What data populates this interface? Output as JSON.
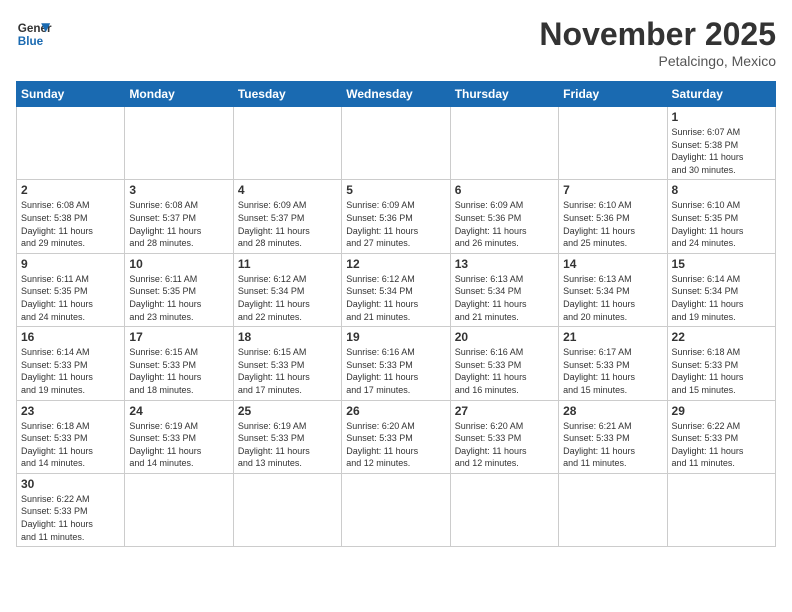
{
  "header": {
    "logo_general": "General",
    "logo_blue": "Blue",
    "month_title": "November 2025",
    "location": "Petalcingo, Mexico"
  },
  "weekdays": [
    "Sunday",
    "Monday",
    "Tuesday",
    "Wednesday",
    "Thursday",
    "Friday",
    "Saturday"
  ],
  "weeks": [
    [
      {
        "day": "",
        "info": ""
      },
      {
        "day": "",
        "info": ""
      },
      {
        "day": "",
        "info": ""
      },
      {
        "day": "",
        "info": ""
      },
      {
        "day": "",
        "info": ""
      },
      {
        "day": "",
        "info": ""
      },
      {
        "day": "1",
        "info": "Sunrise: 6:07 AM\nSunset: 5:38 PM\nDaylight: 11 hours\nand 30 minutes."
      }
    ],
    [
      {
        "day": "2",
        "info": "Sunrise: 6:08 AM\nSunset: 5:38 PM\nDaylight: 11 hours\nand 29 minutes."
      },
      {
        "day": "3",
        "info": "Sunrise: 6:08 AM\nSunset: 5:37 PM\nDaylight: 11 hours\nand 28 minutes."
      },
      {
        "day": "4",
        "info": "Sunrise: 6:09 AM\nSunset: 5:37 PM\nDaylight: 11 hours\nand 28 minutes."
      },
      {
        "day": "5",
        "info": "Sunrise: 6:09 AM\nSunset: 5:36 PM\nDaylight: 11 hours\nand 27 minutes."
      },
      {
        "day": "6",
        "info": "Sunrise: 6:09 AM\nSunset: 5:36 PM\nDaylight: 11 hours\nand 26 minutes."
      },
      {
        "day": "7",
        "info": "Sunrise: 6:10 AM\nSunset: 5:36 PM\nDaylight: 11 hours\nand 25 minutes."
      },
      {
        "day": "8",
        "info": "Sunrise: 6:10 AM\nSunset: 5:35 PM\nDaylight: 11 hours\nand 24 minutes."
      }
    ],
    [
      {
        "day": "9",
        "info": "Sunrise: 6:11 AM\nSunset: 5:35 PM\nDaylight: 11 hours\nand 24 minutes."
      },
      {
        "day": "10",
        "info": "Sunrise: 6:11 AM\nSunset: 5:35 PM\nDaylight: 11 hours\nand 23 minutes."
      },
      {
        "day": "11",
        "info": "Sunrise: 6:12 AM\nSunset: 5:34 PM\nDaylight: 11 hours\nand 22 minutes."
      },
      {
        "day": "12",
        "info": "Sunrise: 6:12 AM\nSunset: 5:34 PM\nDaylight: 11 hours\nand 21 minutes."
      },
      {
        "day": "13",
        "info": "Sunrise: 6:13 AM\nSunset: 5:34 PM\nDaylight: 11 hours\nand 21 minutes."
      },
      {
        "day": "14",
        "info": "Sunrise: 6:13 AM\nSunset: 5:34 PM\nDaylight: 11 hours\nand 20 minutes."
      },
      {
        "day": "15",
        "info": "Sunrise: 6:14 AM\nSunset: 5:34 PM\nDaylight: 11 hours\nand 19 minutes."
      }
    ],
    [
      {
        "day": "16",
        "info": "Sunrise: 6:14 AM\nSunset: 5:33 PM\nDaylight: 11 hours\nand 19 minutes."
      },
      {
        "day": "17",
        "info": "Sunrise: 6:15 AM\nSunset: 5:33 PM\nDaylight: 11 hours\nand 18 minutes."
      },
      {
        "day": "18",
        "info": "Sunrise: 6:15 AM\nSunset: 5:33 PM\nDaylight: 11 hours\nand 17 minutes."
      },
      {
        "day": "19",
        "info": "Sunrise: 6:16 AM\nSunset: 5:33 PM\nDaylight: 11 hours\nand 17 minutes."
      },
      {
        "day": "20",
        "info": "Sunrise: 6:16 AM\nSunset: 5:33 PM\nDaylight: 11 hours\nand 16 minutes."
      },
      {
        "day": "21",
        "info": "Sunrise: 6:17 AM\nSunset: 5:33 PM\nDaylight: 11 hours\nand 15 minutes."
      },
      {
        "day": "22",
        "info": "Sunrise: 6:18 AM\nSunset: 5:33 PM\nDaylight: 11 hours\nand 15 minutes."
      }
    ],
    [
      {
        "day": "23",
        "info": "Sunrise: 6:18 AM\nSunset: 5:33 PM\nDaylight: 11 hours\nand 14 minutes."
      },
      {
        "day": "24",
        "info": "Sunrise: 6:19 AM\nSunset: 5:33 PM\nDaylight: 11 hours\nand 14 minutes."
      },
      {
        "day": "25",
        "info": "Sunrise: 6:19 AM\nSunset: 5:33 PM\nDaylight: 11 hours\nand 13 minutes."
      },
      {
        "day": "26",
        "info": "Sunrise: 6:20 AM\nSunset: 5:33 PM\nDaylight: 11 hours\nand 12 minutes."
      },
      {
        "day": "27",
        "info": "Sunrise: 6:20 AM\nSunset: 5:33 PM\nDaylight: 11 hours\nand 12 minutes."
      },
      {
        "day": "28",
        "info": "Sunrise: 6:21 AM\nSunset: 5:33 PM\nDaylight: 11 hours\nand 11 minutes."
      },
      {
        "day": "29",
        "info": "Sunrise: 6:22 AM\nSunset: 5:33 PM\nDaylight: 11 hours\nand 11 minutes."
      }
    ],
    [
      {
        "day": "30",
        "info": "Sunrise: 6:22 AM\nSunset: 5:33 PM\nDaylight: 11 hours\nand 11 minutes."
      },
      {
        "day": "",
        "info": ""
      },
      {
        "day": "",
        "info": ""
      },
      {
        "day": "",
        "info": ""
      },
      {
        "day": "",
        "info": ""
      },
      {
        "day": "",
        "info": ""
      },
      {
        "day": "",
        "info": ""
      }
    ]
  ]
}
